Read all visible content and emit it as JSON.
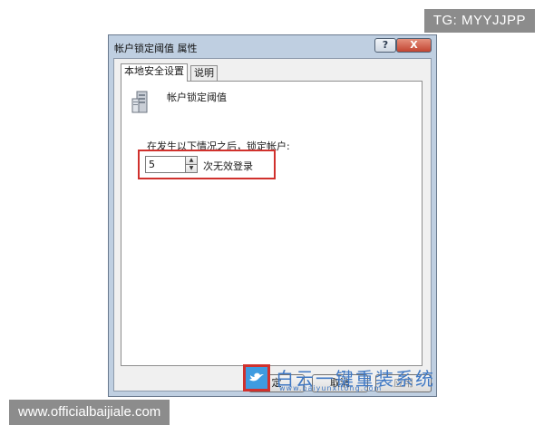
{
  "badges": {
    "telegram": "TG: MYYJJPP",
    "site": "www.officialbaijiale.com"
  },
  "window": {
    "title": "帐户锁定阈值 属性",
    "help_button": "?",
    "close_button": "X"
  },
  "tabs": [
    {
      "label": "本地安全设置",
      "active": true
    },
    {
      "label": "说明",
      "active": false
    }
  ],
  "policy": {
    "icon": "server-policy-icon",
    "name": "帐户锁定阈值"
  },
  "lockout": {
    "label": "在发生以下情况之后，锁定帐户:",
    "value": "5",
    "suffix": "次无效登录"
  },
  "buttons": {
    "ok": "定",
    "cancel": "取消",
    "apply": "应用"
  },
  "watermark": {
    "icon": "bird-logo-icon",
    "text": "白云一键重装系统",
    "url": "www.baiyunxitong.com"
  },
  "colors": {
    "highlight": "#d0312d",
    "badge_bg": "#8c8c8c",
    "watermark": "#3f78c4"
  }
}
